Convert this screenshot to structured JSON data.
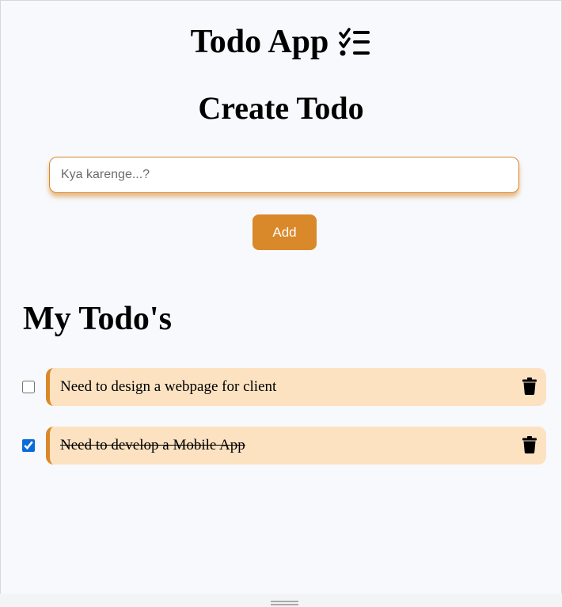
{
  "header": {
    "title": "Todo App",
    "icon": "checklist-icon"
  },
  "create": {
    "heading": "Create Todo",
    "input_placeholder": "Kya karenge...?",
    "input_value": "",
    "add_label": "Add"
  },
  "list": {
    "heading": "My Todo's",
    "items": [
      {
        "text": "Need to design a webpage for client",
        "done": false,
        "icon": "trash-icon"
      },
      {
        "text": "Need to develop a Mobile App",
        "done": true,
        "icon": "trash-icon"
      }
    ]
  },
  "colors": {
    "accent": "#d9882a",
    "card_background": "#fde2c2",
    "page_background": "#f8f9fd"
  }
}
